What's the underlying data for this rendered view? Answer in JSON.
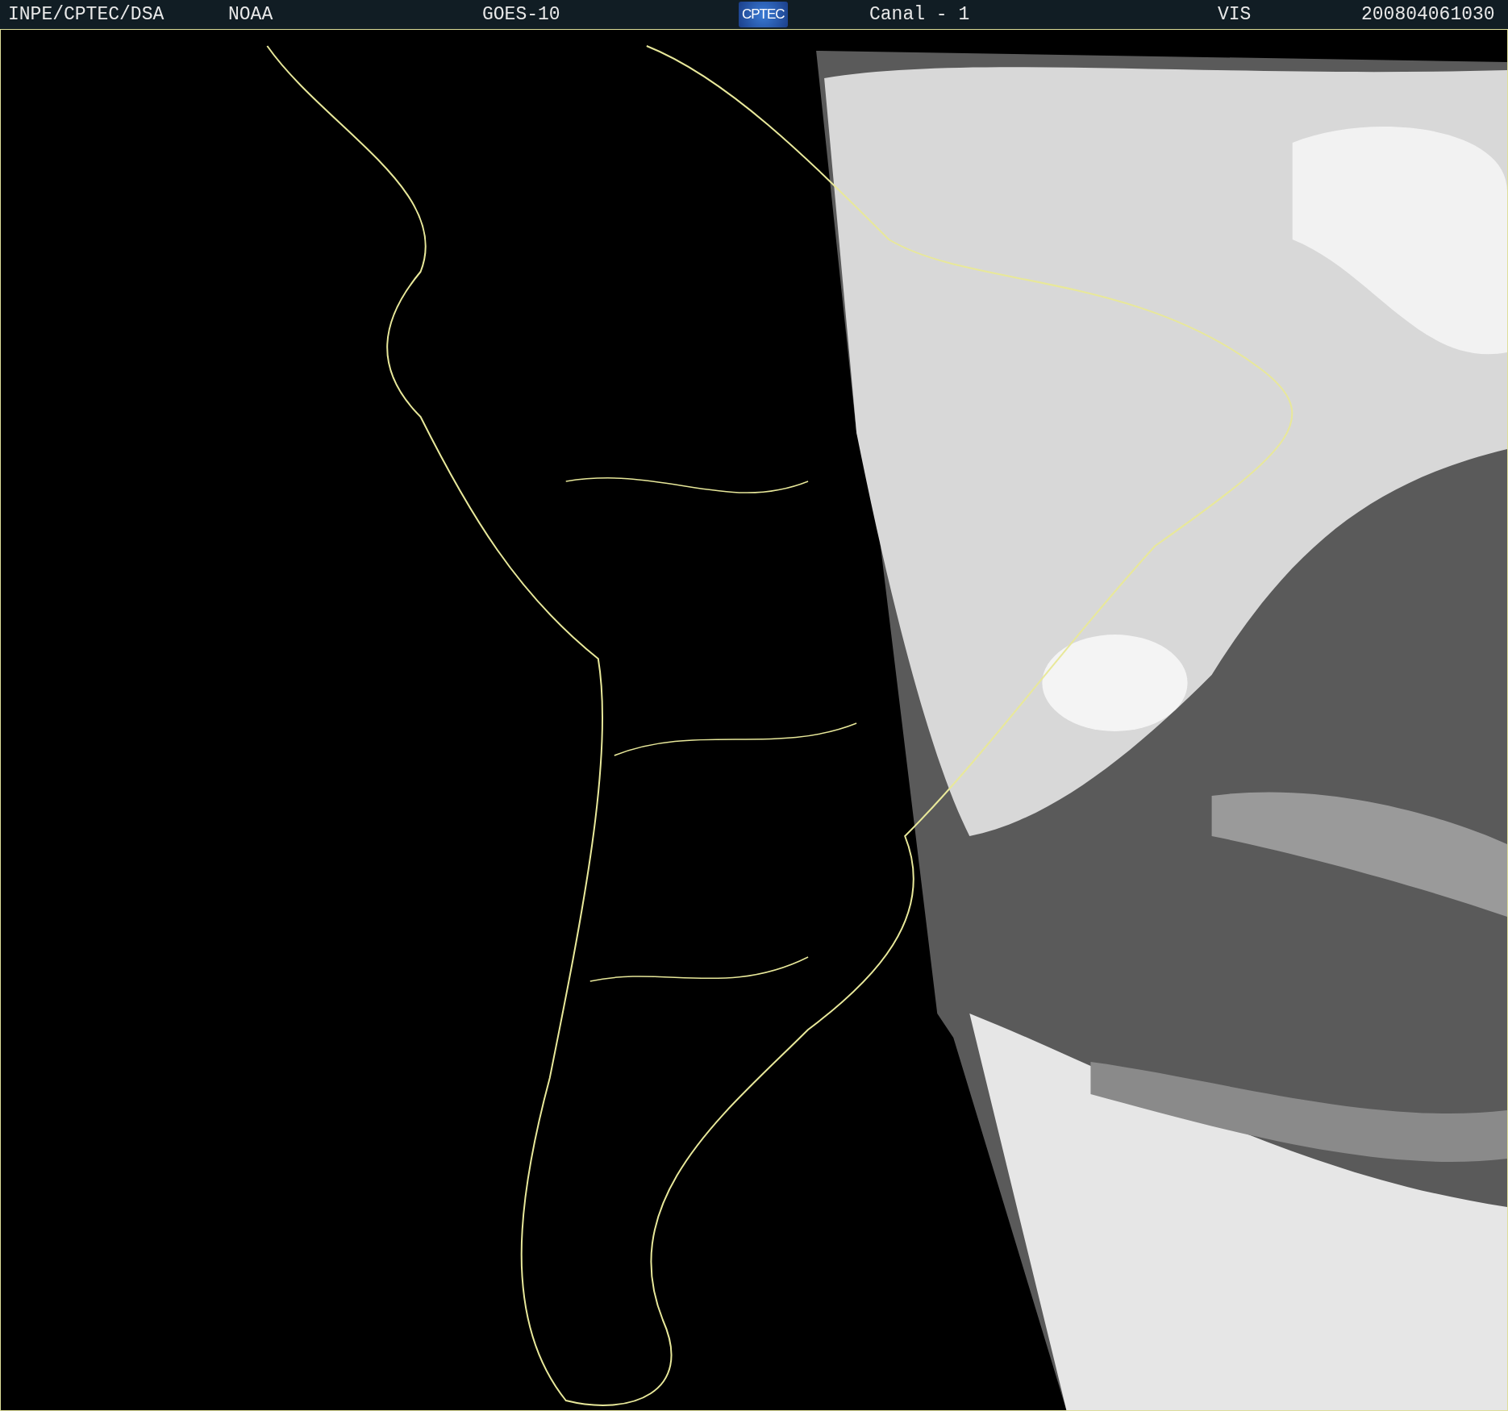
{
  "header": {
    "items": [
      {
        "kind": "text",
        "text": "INPE/CPTEC/DSA"
      },
      {
        "kind": "text",
        "text": "NOAA"
      },
      {
        "kind": "text",
        "text": "GOES-10"
      },
      {
        "kind": "logo",
        "text": "CPTEC"
      },
      {
        "kind": "text",
        "text": "Canal - 1"
      },
      {
        "kind": "text",
        "text": "VIS"
      },
      {
        "kind": "text",
        "text": "200804061030"
      }
    ]
  }
}
